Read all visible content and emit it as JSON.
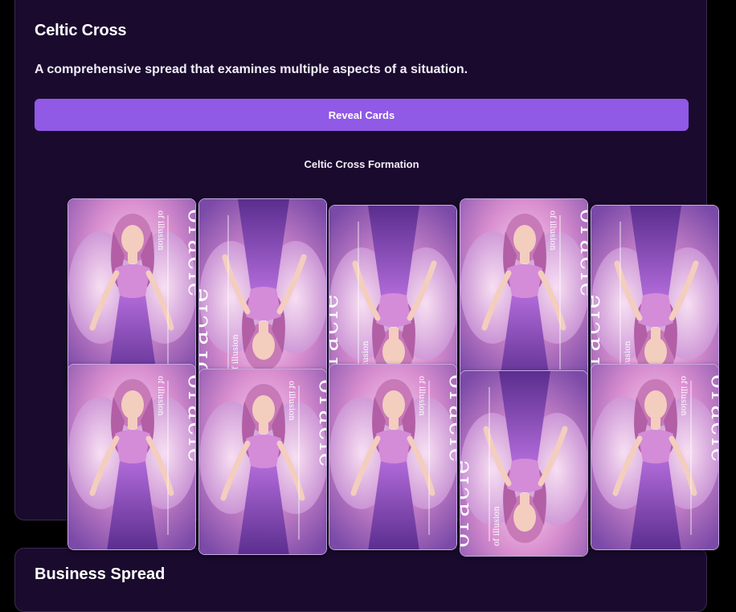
{
  "spread": {
    "title": "Celtic Cross",
    "description": "A comprehensive spread that examines multiple aspects of a situation.",
    "reveal_label": "Reveal Cards",
    "formation_label": "Celtic Cross Formation"
  },
  "next_panel": {
    "title": "Business Spread"
  },
  "card_art": {
    "brand": "oracle",
    "subtitle": "of illusion"
  },
  "cards": [
    {
      "orientation": "upright"
    },
    {
      "orientation": "reversed"
    },
    {
      "orientation": "reversed"
    },
    {
      "orientation": "upright"
    },
    {
      "orientation": "reversed"
    },
    {
      "orientation": "upright"
    },
    {
      "orientation": "upright"
    },
    {
      "orientation": "upright"
    },
    {
      "orientation": "reversed"
    },
    {
      "orientation": "upright"
    }
  ],
  "colors": {
    "background": "#000000",
    "panel": "#1a0b2e",
    "accent": "#9059e6",
    "card_border": "#c9a9e6"
  }
}
